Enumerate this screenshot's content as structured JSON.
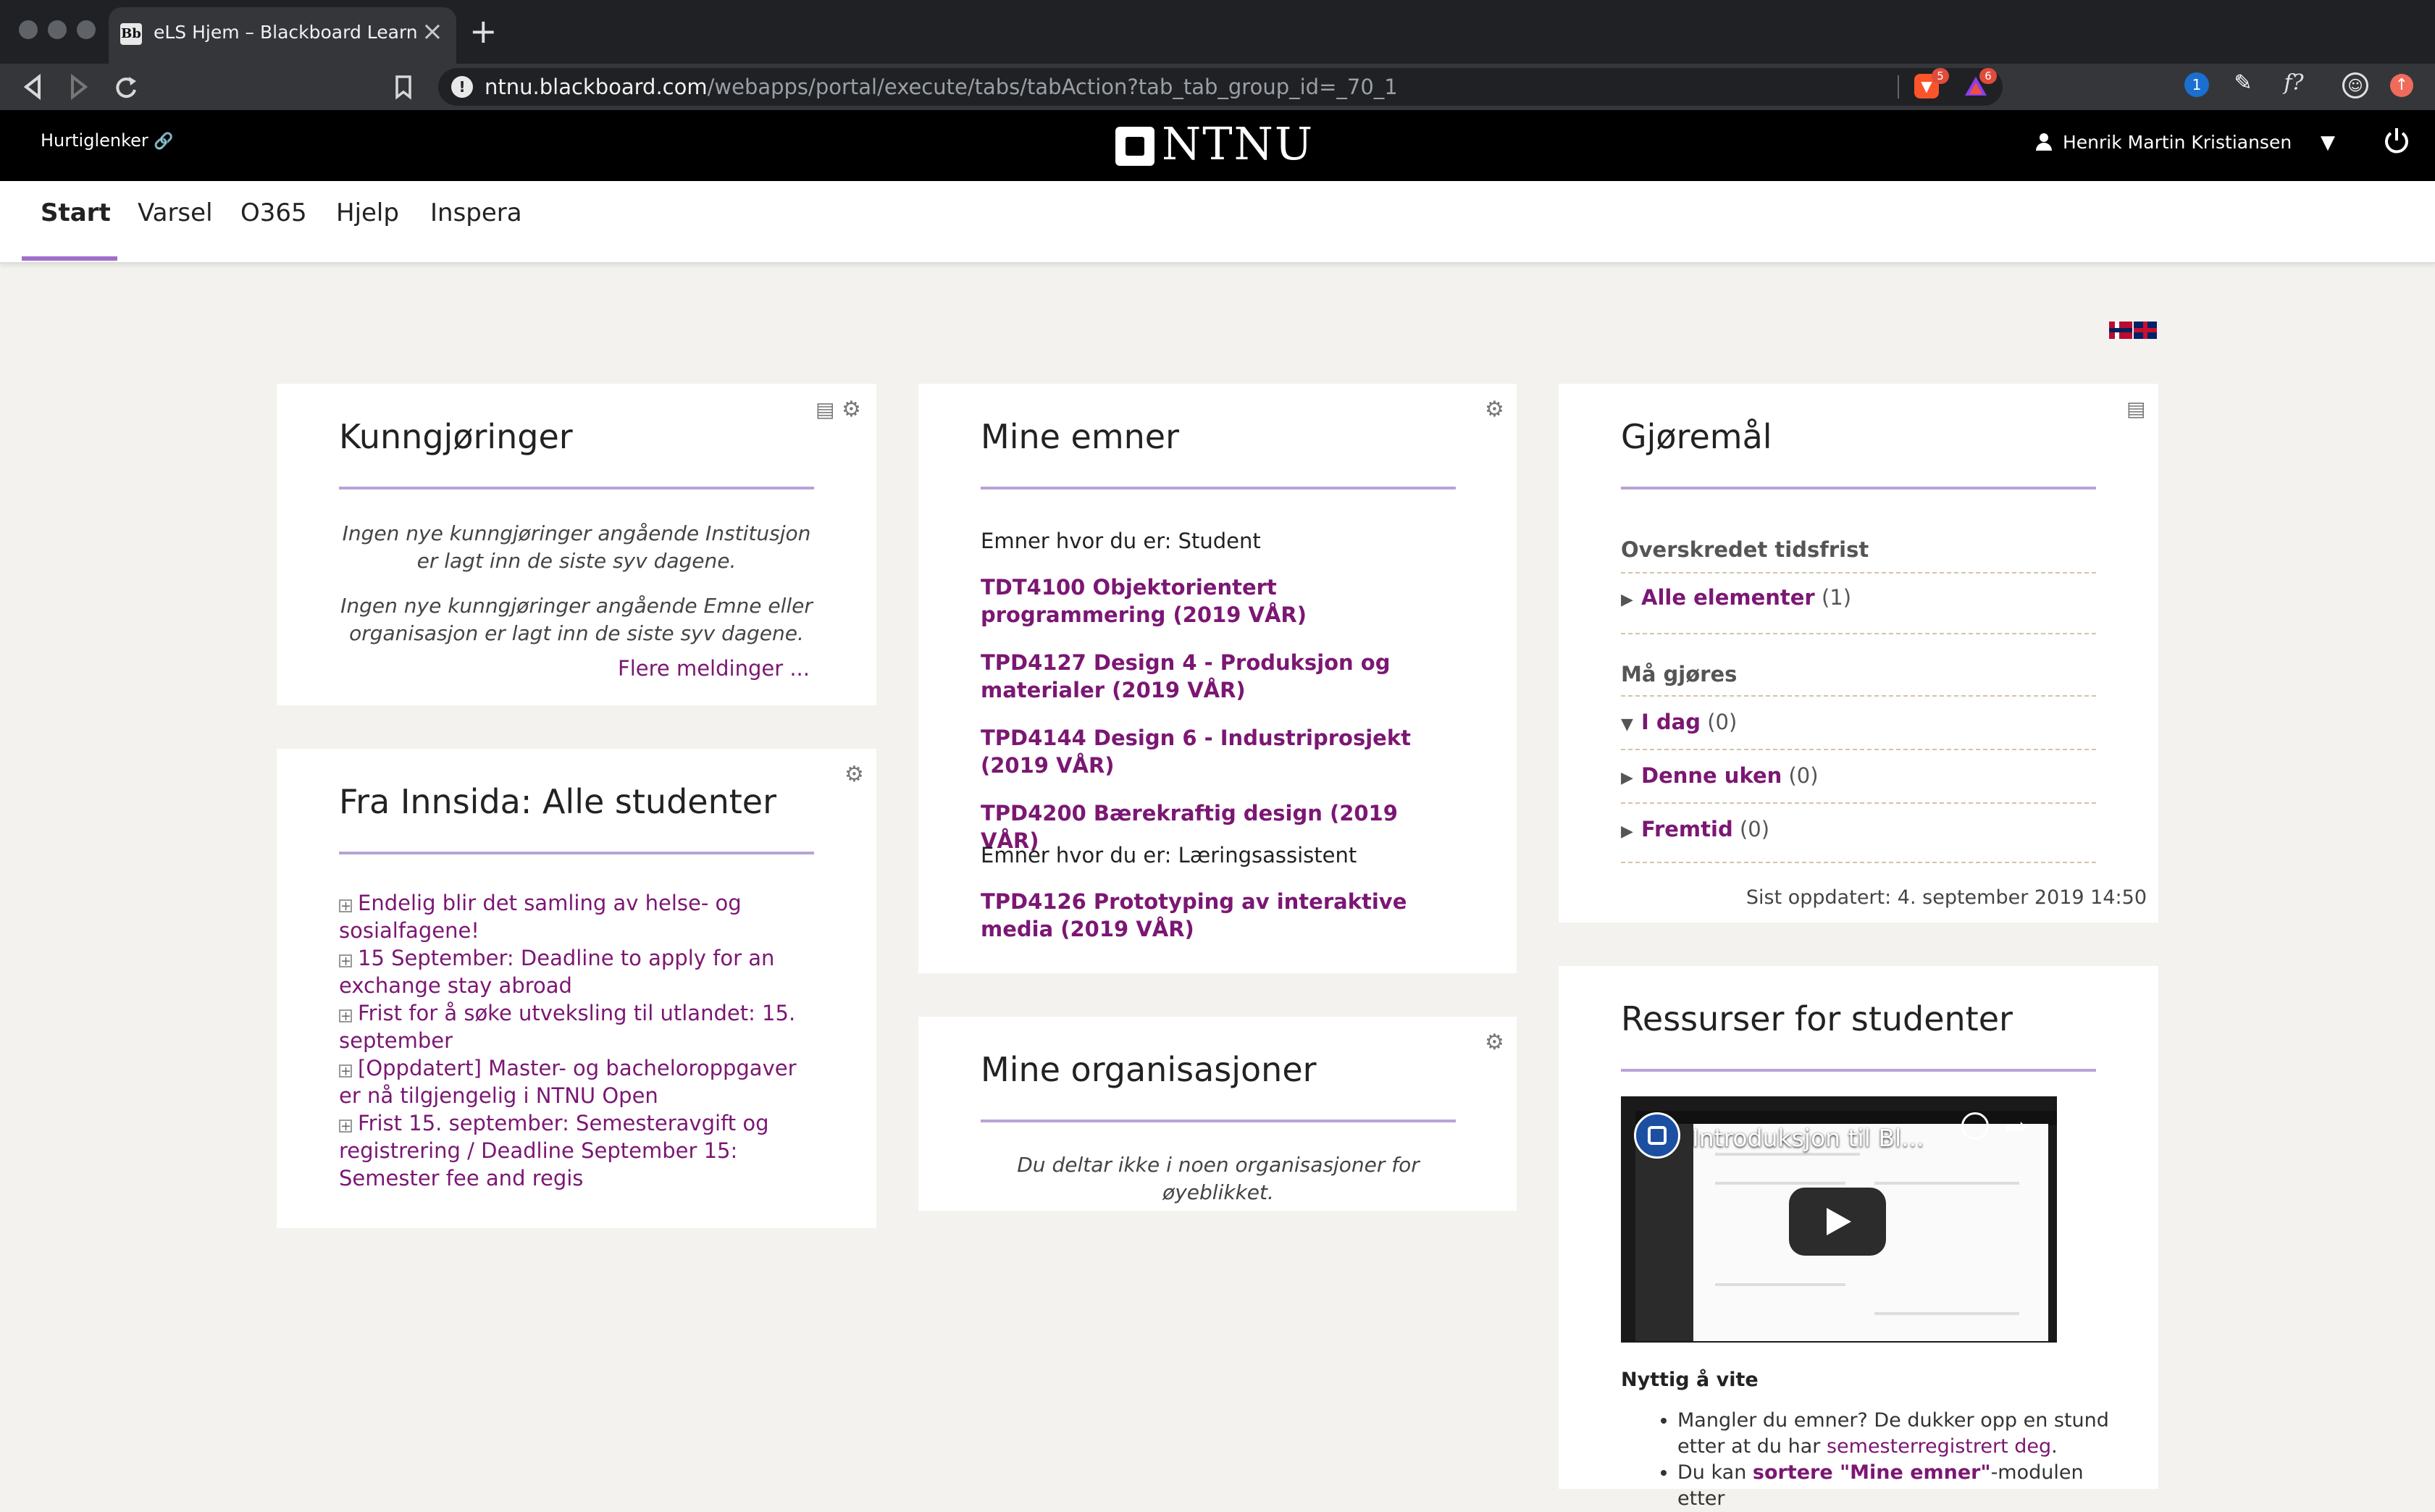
{
  "browser": {
    "tab_title": "eLS Hjem – Blackboard Learn",
    "tab_favicon": "Bb",
    "new_tab": "+",
    "url_host": "ntnu.blackboard.com",
    "url_path": "/webapps/portal/execute/tabs/tabAction?tab_tab_group_id=_70_1",
    "extension_badges": [
      "5",
      "6"
    ],
    "right_icon_text": "f?"
  },
  "header": {
    "quicklinks": "Hurtiglenker",
    "logo_text": "NTNU",
    "user_name": "Henrik Martin Kristiansen"
  },
  "nav": {
    "tabs": [
      {
        "label": "Start",
        "active": true
      },
      {
        "label": "Varsel"
      },
      {
        "label": "O365"
      },
      {
        "label": "Hjelp"
      },
      {
        "label": "Inspera"
      }
    ]
  },
  "announcements": {
    "title": "Kunngjøringer",
    "msg1": "Ingen nye kunngjøringer angående Institusjon er lagt inn de siste syv dagene.",
    "msg2": "Ingen nye kunngjøringer angående Emne eller organisasjon er lagt inn de siste syv dagene.",
    "more": "Flere meldinger ..."
  },
  "innsida": {
    "title": "Fra Innsida: Alle studenter",
    "items": [
      "Endelig blir det samling av helse- og sosialfagene!",
      "15 September: Deadline to apply for an exchange stay abroad",
      "Frist for å søke utveksling til utlandet: 15. september",
      "[Oppdatert] Master- og bacheloroppgaver er nå tilgjengelig i NTNU Open",
      "Frist 15. september: Semesteravgift og registrering / Deadline September 15: Semester fee and regis"
    ]
  },
  "courses": {
    "title": "Mine emner",
    "student_label": "Emner hvor du er: Student",
    "student_courses": [
      "TDT4100 Objektorientert programmering (2019 VÅR)",
      "TPD4127 Design 4 - Produksjon og materialer (2019 VÅR)",
      "TPD4144 Design 6 - Industriprosjekt (2019 VÅR)",
      "TPD4200 Bærekraftig design (2019 VÅR)"
    ],
    "assistant_label": "Emner hvor du er: Læringsassistent",
    "assistant_courses": [
      "TPD4126 Prototyping av interaktive media (2019 VÅR)"
    ]
  },
  "organisations": {
    "title": "Mine organisasjoner",
    "empty": "Du deltar ikke i noen organisasjoner for øyeblikket."
  },
  "todo": {
    "title": "Gjøremål",
    "overdue_heading": "Overskredet tidsfrist",
    "overdue_items": [
      {
        "label": "Alle elementer",
        "count": "(1)"
      }
    ],
    "due_heading": "Må gjøres",
    "due_items": [
      {
        "label": "I dag",
        "count": "(0)"
      },
      {
        "label": "Denne uken",
        "count": "(0)"
      },
      {
        "label": "Fremtid",
        "count": "(0)"
      }
    ],
    "updated": "Sist oppdatert: 4. september 2019 14:50"
  },
  "resources": {
    "title": "Ressurser for studenter",
    "video_title": "Introduksjon til Bl...",
    "useful_heading": "Nyttig å vite",
    "bullet1_text": "Mangler du emner? De dukker opp en stund etter at du har ",
    "bullet1_link": "semesterregistrert deg",
    "bullet1_end": ".",
    "bullet2_text": "Du kan ",
    "bullet2_link": "sortere \"Mine emner\"",
    "bullet2_end": "-modulen etter"
  }
}
